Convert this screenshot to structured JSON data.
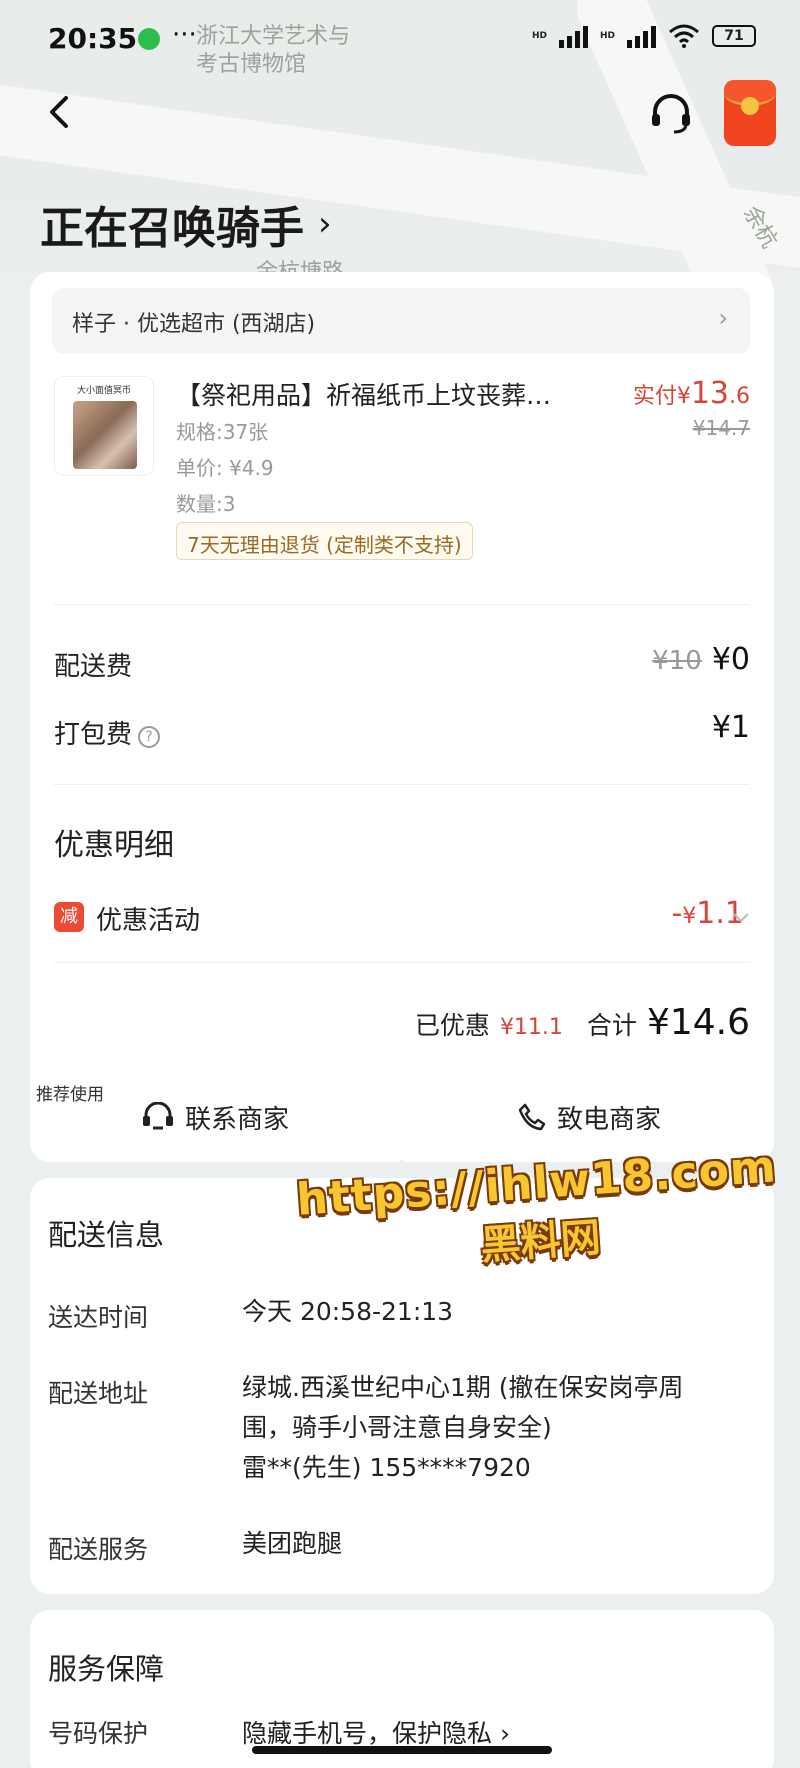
{
  "status_bar": {
    "time": "20:35",
    "dots": "···",
    "battery": "71",
    "net1": "HD",
    "net2": "HD"
  },
  "map": {
    "label1": "浙江大学艺术与",
    "label2": "考古博物馆",
    "label3": "余杭塘路",
    "label4": "余杭"
  },
  "page": {
    "title": "正在召唤骑手",
    "title_chevron": "›"
  },
  "store": {
    "name": "样子 · 优选超市 (西湖店)",
    "chevron": "›"
  },
  "product": {
    "image_label": "大小面值冥币",
    "name": "【祭祀用品】祈福纸币上坟丧葬…",
    "pay_prefix": "实付¥",
    "pay_main": "13",
    "pay_dec": ".6",
    "orig_price": "¥14.7",
    "spec": "规格:37张",
    "unit_price": "单价: ¥4.9",
    "qty": "数量:3",
    "return_tag": "7天无理由退货 (定制类不支持)"
  },
  "fees": {
    "delivery_label": "配送费",
    "delivery_orig": "¥10",
    "delivery_val": "¥0",
    "pack_label": "打包费",
    "pack_val": "¥1"
  },
  "discount": {
    "section_title": "优惠明细",
    "badge": "减",
    "label": "优惠活动",
    "value_prefix": "-",
    "value_yen": "¥",
    "value": "1.1"
  },
  "total": {
    "saved_label": "已优惠",
    "saved_val": "¥11.1",
    "total_label": "合计",
    "total_val": "¥14.6"
  },
  "contact": {
    "recommend": "推荐使用",
    "contact_label": "联系商家",
    "call_label": "致电商家"
  },
  "delivery_info": {
    "title": "配送信息",
    "time_label": "送达时间",
    "time_val": "今天 20:58-21:13",
    "addr_label": "配送地址",
    "addr_val": "绿城.西溪世纪中心1期 (撤在保安岗亭周围，骑手小哥注意自身安全)",
    "contact_val": "雷**(先生) 155****7920",
    "service_label": "配送服务",
    "service_val": "美团跑腿"
  },
  "guarantee": {
    "title": "服务保障",
    "row_label": "号码保护",
    "row_val": "隐藏手机号，保护隐私 ›"
  },
  "watermark": {
    "line1": "https://ihlw18.com",
    "line2": "黑料网"
  },
  "colors": {
    "accent_red": "#d8443a",
    "badge_red": "#ec4a34",
    "watermark_yellow": "#f7c631"
  }
}
